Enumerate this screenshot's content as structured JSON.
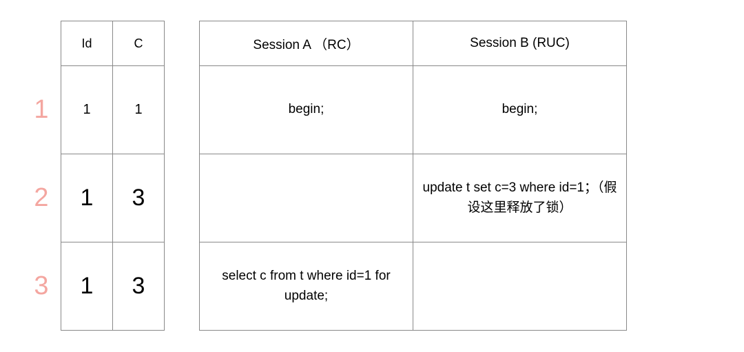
{
  "rowLabels": [
    "1",
    "2",
    "3"
  ],
  "dataTable": {
    "headers": [
      "Id",
      "C"
    ],
    "rows": [
      {
        "id": "1",
        "c": "1",
        "sizeClass": "small"
      },
      {
        "id": "1",
        "c": "3",
        "sizeClass": ""
      },
      {
        "id": "1",
        "c": "3",
        "sizeClass": ""
      }
    ]
  },
  "sessionTable": {
    "headers": [
      "Session A （RC）",
      "Session B (RUC)"
    ],
    "rows": [
      {
        "a": "begin;",
        "b": "begin;"
      },
      {
        "a": "",
        "b": "update t set c=3 where id=1；（假设这里释放了锁）"
      },
      {
        "a": "select c from t where id=1 for update;",
        "b": ""
      }
    ]
  }
}
